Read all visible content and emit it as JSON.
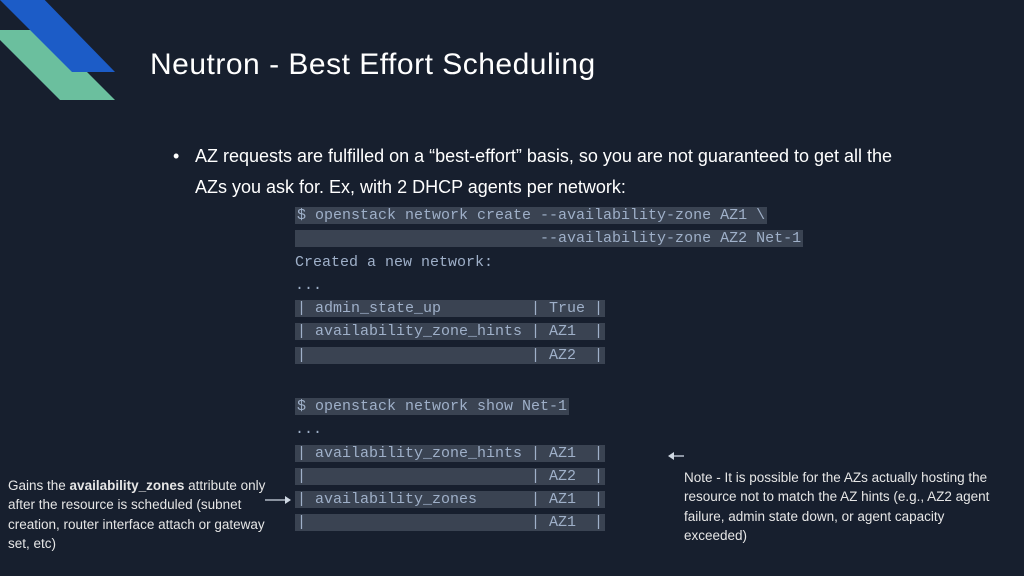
{
  "title": "Neutron - Best Effort Scheduling",
  "bullet_text": "AZ requests are fulfilled on a “best-effort” basis, so you are not guaranteed to get all the AZs you ask for. Ex, with 2 DHCP agents per network:",
  "code_block_1": {
    "line1": "$ openstack network create --availability-zone AZ1 \\",
    "line2": "                           --availability-zone AZ2 Net-1",
    "line3": "Created a new network:",
    "line4": "...",
    "line5": "| admin_state_up          | True |",
    "line6": "| availability_zone_hints | AZ1  |",
    "line7": "|                         | AZ2  |"
  },
  "code_block_2": {
    "line1": "$ openstack network show Net-1",
    "line2": "...",
    "line3": "| availability_zone_hints | AZ1  |",
    "line4": "|                         | AZ2  |",
    "line5": "| availability_zones      | AZ1  |",
    "line6": "|                         | AZ1  |"
  },
  "note_left_prefix": "Gains the ",
  "note_left_bold": "availability_zones",
  "note_left_suffix": " attribute only after the resource is scheduled (subnet creation, router interface attach or gateway set, etc)",
  "note_right": "Note - It is possible for the AZs actually hosting the resource not to match the AZ hints (e.g., AZ2 agent failure, admin state down,  or agent capacity exceeded)",
  "accent_colors": {
    "green": "#6bbf9e",
    "blue": "#1c5cc7"
  }
}
